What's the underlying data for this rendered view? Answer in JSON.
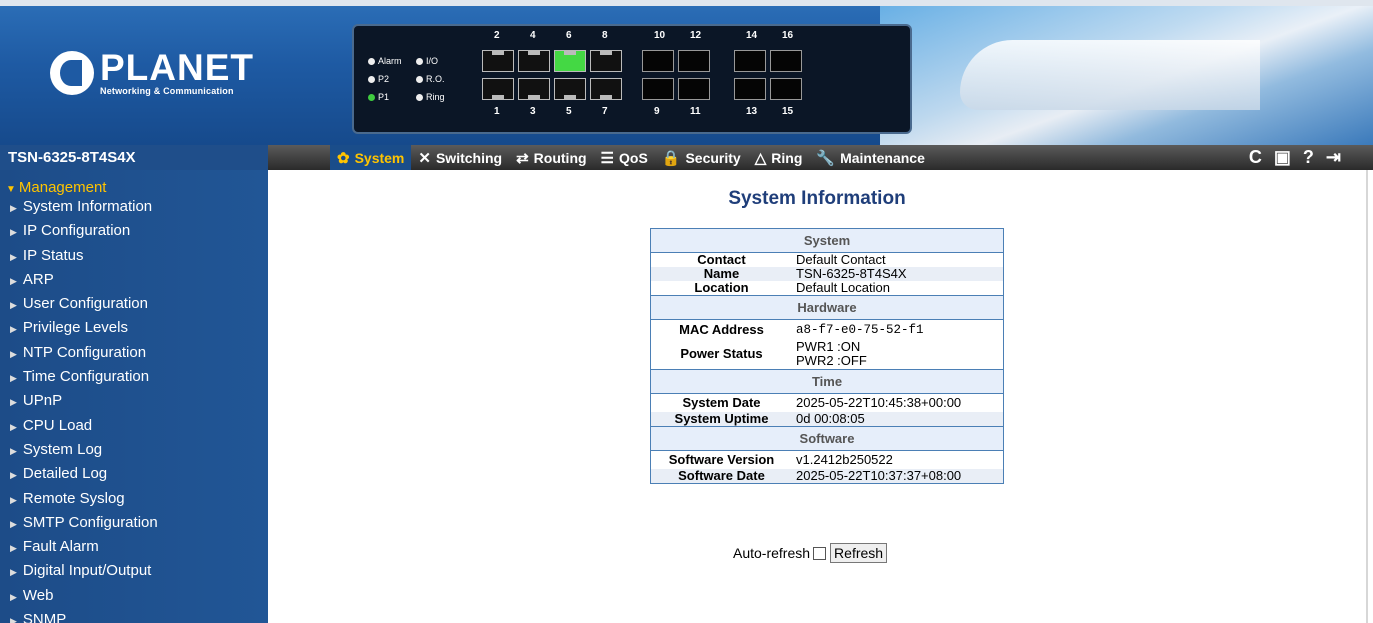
{
  "header": {
    "brand_name": "PLANET",
    "brand_sub": "Networking & Communication"
  },
  "panel": {
    "leds": [
      [
        "Alarm",
        "I/O"
      ],
      [
        "P2",
        "R.O."
      ],
      [
        "P1",
        "Ring"
      ]
    ],
    "top_ports": [
      "2",
      "4",
      "6",
      "8",
      "10",
      "12",
      "14",
      "16"
    ],
    "bottom_ports": [
      "1",
      "3",
      "5",
      "7",
      "9",
      "11",
      "13",
      "15"
    ]
  },
  "model": "TSN-6325-8T4S4X",
  "menu": [
    {
      "label": "System",
      "icon": "gear-icon",
      "glyph": "✿",
      "active": true
    },
    {
      "label": "Switching",
      "icon": "switching-icon",
      "glyph": "✕"
    },
    {
      "label": "Routing",
      "icon": "routing-icon",
      "glyph": "⇄"
    },
    {
      "label": "QoS",
      "icon": "qos-icon",
      "glyph": "☰"
    },
    {
      "label": "Security",
      "icon": "lock-icon",
      "glyph": "🔒"
    },
    {
      "label": "Ring",
      "icon": "ring-icon",
      "glyph": "△"
    },
    {
      "label": "Maintenance",
      "icon": "wrench-icon",
      "glyph": "🔧"
    }
  ],
  "tools": [
    {
      "name": "reload-icon",
      "glyph": "C"
    },
    {
      "name": "save-icon",
      "glyph": "▣"
    },
    {
      "name": "help-icon",
      "glyph": "?"
    },
    {
      "name": "logout-icon",
      "glyph": "⇥"
    }
  ],
  "sidebar": {
    "heading": "Management",
    "items": [
      "System Information",
      "IP Configuration",
      "IP Status",
      "ARP",
      "User Configuration",
      "Privilege Levels",
      "NTP Configuration",
      "Time Configuration",
      "UPnP",
      "CPU Load",
      "System Log",
      "Detailed Log",
      "Remote Syslog",
      "SMTP Configuration",
      "Fault Alarm",
      "Digital Input/Output",
      "Web",
      "SNMP"
    ]
  },
  "page_title": "System Information",
  "info": {
    "system_header": "System",
    "contact_label": "Contact",
    "contact_value": "Default Contact",
    "name_label": "Name",
    "name_value": "TSN-6325-8T4S4X",
    "location_label": "Location",
    "location_value": "Default Location",
    "hardware_header": "Hardware",
    "mac_label": "MAC Address",
    "mac_value": "a8-f7-e0-75-52-f1",
    "power_label": "Power Status",
    "pwr1_value": "PWR1 :ON",
    "pwr2_value": "PWR2 :OFF",
    "time_header": "Time",
    "date_label": "System Date",
    "date_value": "2025-05-22T10:45:38+00:00",
    "uptime_label": "System Uptime",
    "uptime_value": "0d 00:08:05",
    "software_header": "Software",
    "version_label": "Software Version",
    "version_value": "v1.2412b250522",
    "swdate_label": "Software Date",
    "swdate_value": "2025-05-22T10:37:37+08:00"
  },
  "auto_refresh_label": "Auto-refresh",
  "refresh_button": "Refresh"
}
